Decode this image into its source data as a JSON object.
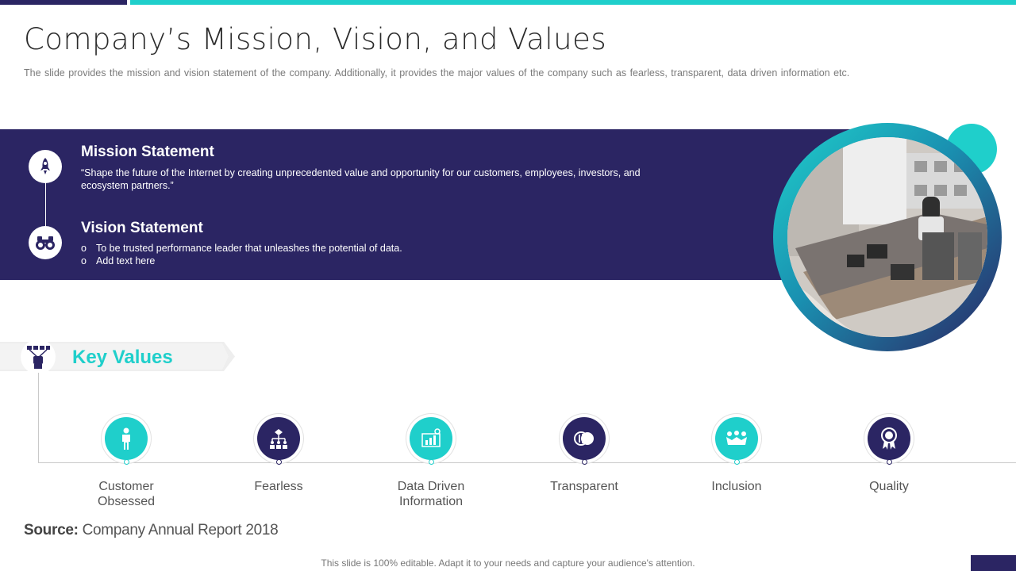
{
  "slide": {
    "title": "Company’s Mission, Vision, and Values",
    "subtitle": "The slide provides  the mission and vision statement of the company. Additionally, it provides  the major values  of the company such as fearless,  transparent,  data driven  information  etc."
  },
  "mission": {
    "heading": "Mission Statement",
    "text": "“Shape the future  of the Internet  by creating unprecedented  value  and opportunity for our customers, employees, investors, and ecosystem partners.”",
    "icon": "rocket-icon"
  },
  "vision": {
    "heading": "Vision Statement",
    "bullets": [
      "To be trusted performance  leader that unleashes the potential of data.",
      "Add text here"
    ],
    "bullet_marker": "o",
    "icon": "binoculars-icon"
  },
  "key_values": {
    "heading": "Key Values",
    "icon": "team-icon",
    "items": [
      {
        "label_line1": "Customer",
        "label_line2": "Obsessed",
        "icon": "person-icon",
        "color": "#1fcfcb"
      },
      {
        "label_line1": "Fearless",
        "label_line2": "",
        "icon": "hierarchy-icon",
        "color": "#2b2563"
      },
      {
        "label_line1": "Data Driven",
        "label_line2": "Information",
        "icon": "data-chart-icon",
        "color": "#1fcfcb"
      },
      {
        "label_line1": "Transparent",
        "label_line2": "",
        "icon": "overlap-circles-icon",
        "color": "#2b2563"
      },
      {
        "label_line1": "Inclusion",
        "label_line2": "",
        "icon": "group-icon",
        "color": "#1fcfcb"
      },
      {
        "label_line1": "Quality",
        "label_line2": "",
        "icon": "award-badge-icon",
        "color": "#2b2563"
      }
    ]
  },
  "source": {
    "label": "Source:",
    "text": " Company Annual Report 2018"
  },
  "footer": "This slide is 100% editable. Adapt it to your needs and capture your audience's attention.",
  "colors": {
    "navy": "#2b2563",
    "teal": "#1fcfcb"
  }
}
